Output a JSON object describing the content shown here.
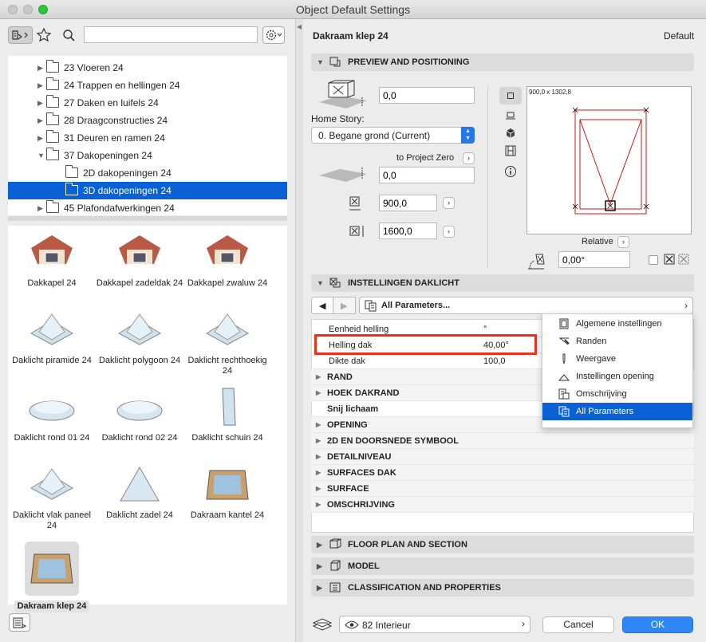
{
  "window": {
    "title": "Object Default Settings"
  },
  "search": {
    "placeholder": ""
  },
  "tree": [
    {
      "label": "23 Vloeren 24",
      "level": 1,
      "expanded": false
    },
    {
      "label": "24 Trappen en hellingen 24",
      "level": 1,
      "expanded": false
    },
    {
      "label": "27 Daken en luifels 24",
      "level": 1,
      "expanded": false
    },
    {
      "label": "28 Draagconstructies 24",
      "level": 1,
      "expanded": false
    },
    {
      "label": "31 Deuren en ramen 24",
      "level": 1,
      "expanded": false
    },
    {
      "label": "37 Dakopeningen 24",
      "level": 1,
      "expanded": true
    },
    {
      "label": "2D dakopeningen 24",
      "level": 2
    },
    {
      "label": "3D dakopeningen 24",
      "level": 2,
      "selected": true
    },
    {
      "label": "45 Plafondafwerkingen 24",
      "level": 1,
      "expanded": false
    }
  ],
  "objects": [
    {
      "label": "Dakkapel 24"
    },
    {
      "label": "Dakkapel zadeldak 24"
    },
    {
      "label": "Dakkapel zwaluw 24"
    },
    {
      "label": "Daklicht piramide 24"
    },
    {
      "label": "Daklicht polygoon 24"
    },
    {
      "label": "Daklicht rechthoekig 24"
    },
    {
      "label": "Daklicht rond 01 24"
    },
    {
      "label": "Daklicht rond 02 24"
    },
    {
      "label": "Daklicht schuin 24"
    },
    {
      "label": "Daklicht vlak paneel 24"
    },
    {
      "label": "Daklicht zadel 24"
    },
    {
      "label": "Dakraam kantel 24"
    },
    {
      "label": "Dakraam klep 24",
      "selected": true
    }
  ],
  "header": {
    "object_name": "Dakraam klep 24",
    "default_label": "Default"
  },
  "preview": {
    "section_title": "PREVIEW AND POSITIONING",
    "elevation": "0,0",
    "home_story_label": "Home Story:",
    "home_story_value": "0. Begane grond (Current)",
    "project_zero_label": "to Project Zero",
    "project_zero_value": "0,0",
    "width": "900,0",
    "height": "1600,0",
    "size_readout": "900,0 x 1302,8",
    "relative_label": "Relative",
    "angle": "0,00°"
  },
  "settings": {
    "section_title": "INSTELLINGEN DAKLICHT",
    "nav_label": "All Parameters...",
    "params": [
      {
        "label": "Eenheid helling",
        "value": "°",
        "type": "param"
      },
      {
        "label": "Helling dak",
        "value": "40,00°",
        "type": "param",
        "highlight": true
      },
      {
        "label": "Dikte dak",
        "value": "100,0",
        "type": "param"
      },
      {
        "label": "RAND",
        "type": "group"
      },
      {
        "label": "HOEK DAKRAND",
        "type": "group"
      },
      {
        "label": "Snij lichaam",
        "value": "",
        "type": "bold"
      },
      {
        "label": "OPENING",
        "type": "group"
      },
      {
        "label": "2D EN DOORSNEDE SYMBOOL",
        "type": "group"
      },
      {
        "label": "DETAILNIVEAU",
        "type": "group"
      },
      {
        "label": "SURFACES DAK",
        "type": "group"
      },
      {
        "label": "SURFACE",
        "type": "group"
      },
      {
        "label": "OMSCHRIJVING",
        "type": "group"
      }
    ],
    "menu": [
      {
        "label": "Algemene instellingen",
        "icon": "general-settings-icon"
      },
      {
        "label": "Randen",
        "icon": "edges-icon"
      },
      {
        "label": "Weergave",
        "icon": "display-icon"
      },
      {
        "label": "Instellingen opening",
        "icon": "opening-settings-icon"
      },
      {
        "label": "Omschrijving",
        "icon": "description-icon"
      },
      {
        "label": "All Parameters",
        "icon": "all-parameters-icon",
        "selected": true
      }
    ]
  },
  "sections": {
    "floor_plan": "FLOOR PLAN AND SECTION",
    "model": "MODEL",
    "classification": "CLASSIFICATION AND PROPERTIES"
  },
  "footer": {
    "layer": "82 Interieur",
    "cancel": "Cancel",
    "ok": "OK"
  },
  "colors": {
    "accent": "#0a61d6",
    "highlight_box": "#e8341c",
    "preview_line": "#d01414"
  }
}
